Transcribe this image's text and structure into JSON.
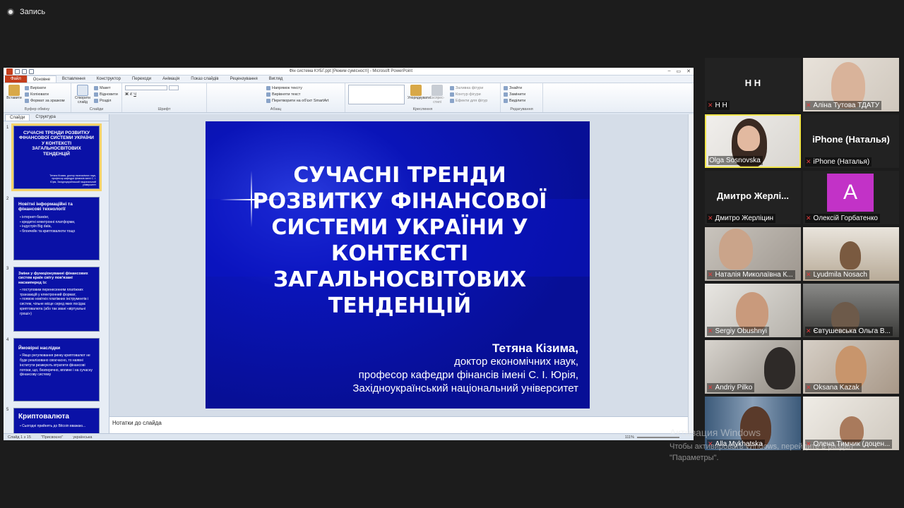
{
  "recording": {
    "label": "Запись"
  },
  "powerpoint": {
    "window_title": "Фін система КУБГ.ppt [Режим сумісності] - Microsoft PowerPoint",
    "tabs": [
      "Файл",
      "Основне",
      "Вставлення",
      "Конструктор",
      "Переходи",
      "Анімація",
      "Показ слайдів",
      "Рецензування",
      "Вигляд"
    ],
    "ribbon": {
      "clipboard": {
        "label": "Буфер обміну",
        "paste": "Вставити",
        "cut": "Вирізати",
        "copy": "Копіювати",
        "format": "Формат за зразком"
      },
      "slides": {
        "label": "Слайди",
        "new": "Створити слайд",
        "layout": "Макет",
        "reset": "Відновити",
        "section": "Розділ"
      },
      "font": {
        "label": "Шрифт"
      },
      "paragraph": {
        "label": "Абзац",
        "direction": "Напрямок тексту",
        "align": "Вирівняти текст",
        "smartart": "Перетворити на об'єкт SmartArt"
      },
      "drawing": {
        "label": "Креслення",
        "arrange": "Упорядкувати",
        "styles": "Експрес-стилі",
        "fill": "Заливка фігури",
        "outline": "Контур фігури",
        "effects": "Ефекти для фігур"
      },
      "editing": {
        "label": "Редагування",
        "find": "Знайти",
        "replace": "Замінити",
        "select": "Виділити"
      }
    },
    "pane_tabs": [
      "Слайди",
      "Структура"
    ],
    "thumbnails": [
      {
        "num": "1",
        "title": "СУЧАСНІ ТРЕНДИ РОЗВИТКУ ФІНАНСОВОЇ СИСТЕМИ УКРАЇНИ У КОНТЕКСТІ ЗАГАЛЬНОСВІТОВИХ ТЕНДЕНЦІЙ",
        "sig": "Тетяна Кізима, доктор економічних наук, професор кафедри фінансів імені С. І. Юрія, Західноукраїнський національний університет"
      },
      {
        "num": "2",
        "title": "Новітні інформаційні та фінансові технології",
        "items": [
          "інтернет-банкінг,",
          "кредитні електронні платформи,",
          "індустрія Big data,",
          "блокчейн та криптовалюти тощо"
        ]
      },
      {
        "num": "3",
        "title": "Зміни у функціонуванні фінансових систем країн світу пов'язані насамперед із:",
        "items": [
          "поступовим перенесенням платіжних транзакцій у електронний формат,",
          "появою новітніх платіжних інструментів і систем, чільне місце серед яких посідає криптовалюта (або так звані «віртуальні гроші»)"
        ]
      },
      {
        "num": "4",
        "title": "Ймовірні наслідки",
        "items": [
          "Якщо регулювання ринку криптовалют не буде реалізовано своєчасно, то наявні інститути ризикують втратити фінансові потоки, що, безперечно, вплине і на сучасну фінансову систему"
        ]
      },
      {
        "num": "5",
        "title": "Криптовалюта",
        "items": [
          "Сьогодні прийнять до Bitcoin вважаю..."
        ]
      }
    ],
    "slide": {
      "title": "СУЧАСНІ ТРЕНДИ РОЗВИТКУ ФІНАНСОВОЇ СИСТЕМИ УКРАЇНИ У КОНТЕКСТІ ЗАГАЛЬНОСВІТОВИХ ТЕНДЕНЦІЙ",
      "author": "Тетяна Кізима,",
      "degree": "доктор економічних наук,",
      "position": "професор кафедри фінансів імені С. І. Юрія,",
      "university": "Західноукраїнський національний університет"
    },
    "notes_placeholder": "Нотатки до слайда",
    "status": {
      "slide": "Слайд 1 з 15",
      "theme": "\"Присвоєно\"",
      "language": "українська",
      "zoom": "111%"
    }
  },
  "participants": [
    {
      "name": "Н Н",
      "display": "Н Н",
      "muted": true,
      "video": false
    },
    {
      "name": "Аліна Тутова ТДАТУ",
      "muted": true,
      "video": true
    },
    {
      "name": "Olga Sosnovska",
      "muted": false,
      "video": true,
      "speaking": true
    },
    {
      "name": "iPhone (Наталья)",
      "display": "iPhone (Наталья)",
      "muted": true,
      "video": false
    },
    {
      "name": "Дмитро Жерліцин",
      "display": "Дмитро Жерлі...",
      "muted": true,
      "video": false
    },
    {
      "name": "Олексій Горбатенко",
      "avatar": "A",
      "muted": true,
      "video": false
    },
    {
      "name": "Наталія Миколаївна К...",
      "muted": true,
      "video": true
    },
    {
      "name": "Lyudmila Nosach",
      "muted": true,
      "video": true
    },
    {
      "name": "Sergiy Obushnyi",
      "muted": true,
      "video": true
    },
    {
      "name": "Євтушевська Ольга В...",
      "muted": true,
      "video": true
    },
    {
      "name": "Andriy Pilko",
      "muted": true,
      "video": true
    },
    {
      "name": "Oksana Kazak",
      "muted": true,
      "video": true
    },
    {
      "name": "Alla Mykhatska",
      "muted": true,
      "video": true
    },
    {
      "name": "Олена Тимчик (доцен...",
      "muted": true,
      "video": true
    }
  ],
  "windows_activation": {
    "title": "Активация Windows",
    "text": "Чтобы активировать Windows, перейдите в раздел \"Параметры\"."
  },
  "colors": {
    "slide_bg": "#0a14b8",
    "speaking_border": "#f2e64a",
    "muted_mic": "#e03a3a",
    "avatar_a": "#c232c7"
  }
}
